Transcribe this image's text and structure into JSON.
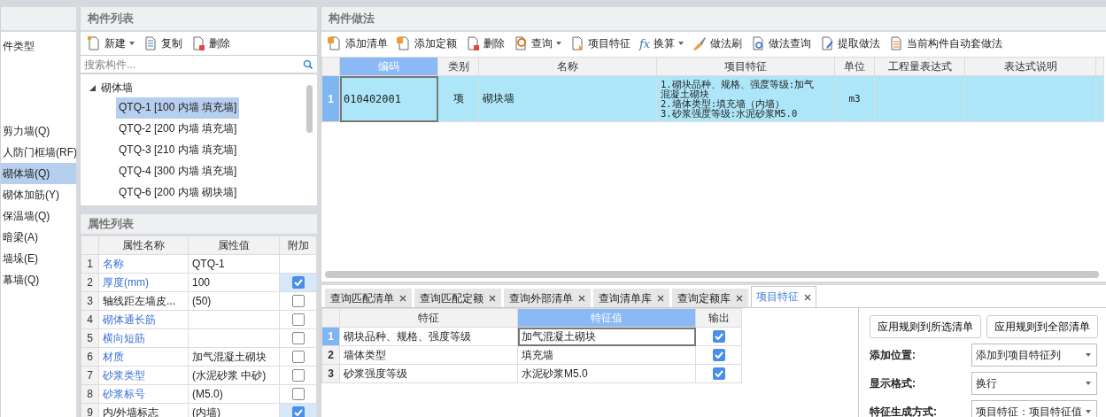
{
  "type_panel": {
    "root_label": "件类型",
    "items": [
      {
        "label": "剪力墙(Q)",
        "selected": false
      },
      {
        "label": "人防门框墙(RF)",
        "selected": false
      },
      {
        "label": "砌体墙(Q)",
        "selected": true
      },
      {
        "label": "砌体加筋(Y)",
        "selected": false
      },
      {
        "label": "保温墙(Q)",
        "selected": false
      },
      {
        "label": "暗梁(A)",
        "selected": false
      },
      {
        "label": "墙垛(E)",
        "selected": false
      },
      {
        "label": "幕墙(Q)",
        "selected": false
      }
    ]
  },
  "component_list": {
    "title": "构件列表",
    "toolbar": [
      {
        "kind": "new",
        "label": "新建",
        "dropdown": true
      },
      {
        "kind": "copy",
        "label": "复制",
        "dropdown": false
      },
      {
        "kind": "delete",
        "label": "删除",
        "dropdown": false
      }
    ],
    "search": {
      "placeholder": "搜索构件..."
    },
    "tree": {
      "label": "砌体墙",
      "expanded": true,
      "children": [
        {
          "label": "QTQ-1 [100 内墙 填充墙]",
          "selected": true
        },
        {
          "label": "QTQ-2 [200 内墙 填充墙]",
          "selected": false
        },
        {
          "label": "QTQ-3 [210 内墙 填充墙]",
          "selected": false
        },
        {
          "label": "QTQ-4 [300 内墙 填充墙]",
          "selected": false
        },
        {
          "label": "QTQ-6 [200 内墙 砌块墙]",
          "selected": false
        }
      ]
    }
  },
  "properties": {
    "title": "属性列表",
    "columns": [
      "属性名称",
      "属性值",
      "附加"
    ],
    "rows": [
      {
        "index": "1",
        "name": "名称",
        "value": "QTQ-1",
        "kind": "common"
      },
      {
        "index": "2",
        "name": "厚度(mm)",
        "value": "100",
        "kind": "common",
        "attached": true
      },
      {
        "index": "3",
        "name": "轴线距左墙皮...",
        "value": "(50)",
        "kind": "private",
        "attached": false
      },
      {
        "index": "4",
        "name": "砌体通长筋",
        "value": "",
        "kind": "common",
        "attached": false
      },
      {
        "index": "5",
        "name": "横向短筋",
        "value": "",
        "kind": "common",
        "attached": false
      },
      {
        "index": "6",
        "name": "材质",
        "value": "加气混凝土砌块",
        "kind": "common",
        "attached": false
      },
      {
        "index": "7",
        "name": "砂浆类型",
        "value": "(水泥砂浆 中砂)",
        "kind": "common",
        "attached": false
      },
      {
        "index": "8",
        "name": "砂浆标号",
        "value": "(M5.0)",
        "kind": "common",
        "attached": false
      },
      {
        "index": "9",
        "name": "内/外墙标志",
        "value": "(内墙)",
        "kind": "private",
        "attached": true
      }
    ]
  },
  "method_panel": {
    "title": "构件做法",
    "toolbar": [
      {
        "kind": "add-list",
        "label": "添加清单",
        "dropdown": false
      },
      {
        "kind": "add-quota",
        "label": "添加定额",
        "dropdown": false
      },
      {
        "kind": "delete",
        "label": "删除",
        "dropdown": false
      },
      {
        "kind": "query",
        "label": "查询",
        "dropdown": true
      },
      {
        "kind": "feature",
        "label": "项目特征",
        "dropdown": false
      },
      {
        "kind": "fx",
        "glyph": "fx",
        "label": "换算",
        "dropdown": true
      },
      {
        "kind": "brush",
        "label": "做法刷",
        "dropdown": false
      },
      {
        "kind": "method-query",
        "label": "做法查询",
        "dropdown": false
      },
      {
        "kind": "extract",
        "label": "提取做法",
        "dropdown": false
      },
      {
        "kind": "auto",
        "label": "当前构件自动套做法",
        "dropdown": false
      }
    ],
    "columns": [
      {
        "label": "编码",
        "selected": true
      },
      {
        "label": "类别",
        "selected": false
      },
      {
        "label": "名称",
        "selected": false
      },
      {
        "label": "项目特征",
        "selected": false
      },
      {
        "label": "单位",
        "selected": false
      },
      {
        "label": "工程量表达式",
        "selected": false
      },
      {
        "label": "表达式说明",
        "selected": false
      }
    ],
    "rows": [
      {
        "index": "1",
        "selected": true,
        "code": "010402001",
        "category": "项",
        "name": "砌块墙",
        "feature_lines": [
          "1.砌块品种、规格、强度等级:加气",
          "混凝土砌块",
          "2.墙体类型:填充墙（内墙）",
          "3.砂浆强度等级:水泥砂浆M5.0"
        ],
        "unit": "m3"
      }
    ]
  },
  "bottom_tabs": [
    {
      "label": "查询匹配清单",
      "selected": false
    },
    {
      "label": "查询匹配定额",
      "selected": false
    },
    {
      "label": "查询外部清单",
      "selected": false
    },
    {
      "label": "查询清单库",
      "selected": false
    },
    {
      "label": "查询定额库",
      "selected": false
    },
    {
      "label": "项目特征",
      "selected": true
    }
  ],
  "feature_table": {
    "columns": [
      {
        "label": "特征",
        "selected": false
      },
      {
        "label": "特征值",
        "selected": true
      },
      {
        "label": "输出",
        "selected": false
      }
    ],
    "rows": [
      {
        "index": "1",
        "selected": true,
        "feature": "砌块品种、规格、强度等级",
        "value": "加气混凝土砌块",
        "output": true
      },
      {
        "index": "2",
        "selected": false,
        "feature": "墙体类型",
        "value": "填充墙",
        "output": true
      },
      {
        "index": "3",
        "selected": false,
        "feature": "砂浆强度等级",
        "value": "水泥砂浆M5.0",
        "output": true
      }
    ]
  },
  "rule_panel": {
    "buttons": [
      "应用规则到所选清单",
      "应用规则到全部清单"
    ],
    "settings": [
      {
        "label": "添加位置:",
        "value": "添加到项目特征列"
      },
      {
        "label": "显示格式:",
        "value": "换行"
      },
      {
        "label": "特征生成方式:",
        "value": "项目特征：项目特征值"
      }
    ]
  }
}
